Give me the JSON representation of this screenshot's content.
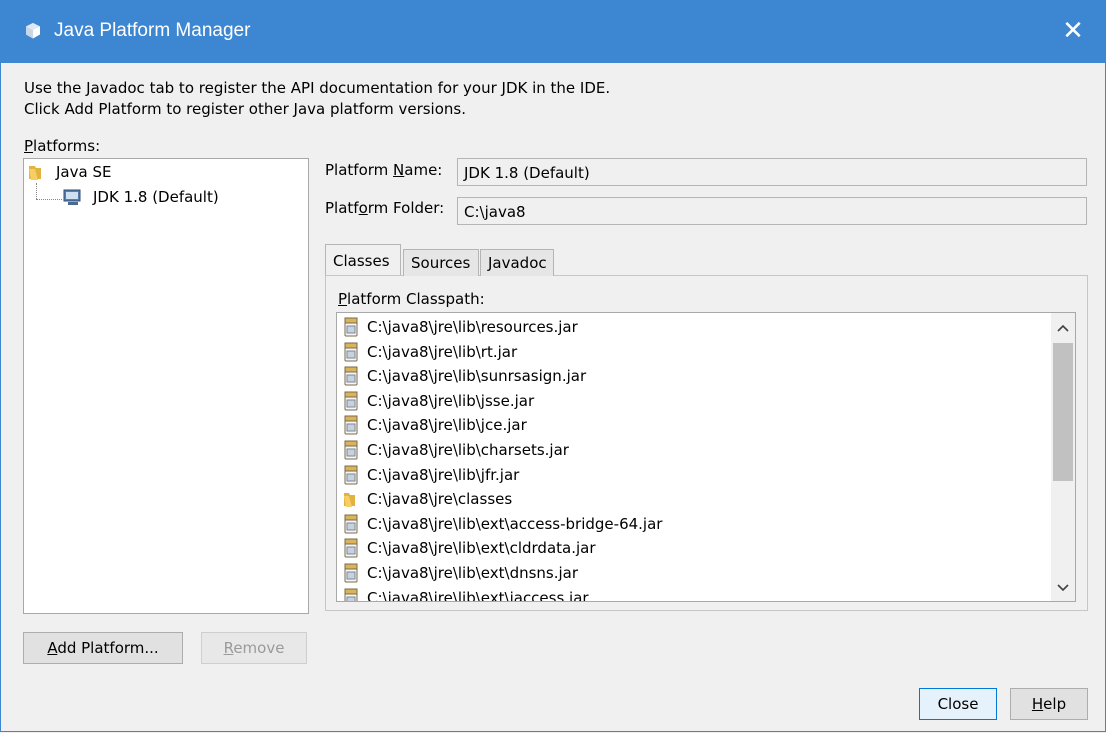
{
  "window": {
    "title": "Java Platform Manager",
    "close_glyph": "✕"
  },
  "description": {
    "line1": "Use the Javadoc tab to register the API documentation for your JDK in the IDE.",
    "line2": "Click Add Platform to register other Java platform versions."
  },
  "platforms": {
    "label_mnemonic": "P",
    "label_rest": "latforms:",
    "tree": {
      "root": "Java SE",
      "child": "JDK 1.8 (Default)"
    }
  },
  "details": {
    "name_label_pre": "Platform ",
    "name_label_mnemonic": "N",
    "name_label_post": "ame:",
    "name_value": "JDK 1.8 (Default)",
    "folder_label_pre": "Platf",
    "folder_label_mnemonic": "o",
    "folder_label_post": "rm Folder:",
    "folder_value": "C:\\java8"
  },
  "tabs": {
    "classes": "Classes",
    "sources": "Sources",
    "javadoc": "Javadoc"
  },
  "classpath": {
    "label_mnemonic": "P",
    "label_rest": "latform Classpath:",
    "items": [
      {
        "path": "C:\\java8\\jre\\lib\\resources.jar",
        "icon": "jar-icon"
      },
      {
        "path": "C:\\java8\\jre\\lib\\rt.jar",
        "icon": "jar-icon"
      },
      {
        "path": "C:\\java8\\jre\\lib\\sunrsasign.jar",
        "icon": "jar-icon"
      },
      {
        "path": "C:\\java8\\jre\\lib\\jsse.jar",
        "icon": "jar-icon"
      },
      {
        "path": "C:\\java8\\jre\\lib\\jce.jar",
        "icon": "jar-icon"
      },
      {
        "path": "C:\\java8\\jre\\lib\\charsets.jar",
        "icon": "jar-icon"
      },
      {
        "path": "C:\\java8\\jre\\lib\\jfr.jar",
        "icon": "jar-icon"
      },
      {
        "path": "C:\\java8\\jre\\classes",
        "icon": "folder-icon"
      },
      {
        "path": "C:\\java8\\jre\\lib\\ext\\access-bridge-64.jar",
        "icon": "jar-icon"
      },
      {
        "path": "C:\\java8\\jre\\lib\\ext\\cldrdata.jar",
        "icon": "jar-icon"
      },
      {
        "path": "C:\\java8\\jre\\lib\\ext\\dnsns.jar",
        "icon": "jar-icon"
      },
      {
        "path": "C:\\java8\\jre\\lib\\ext\\jaccess.jar",
        "icon": "jar-icon"
      }
    ]
  },
  "buttons": {
    "add_mnemonic": "A",
    "add_rest": "dd Platform...",
    "remove_mnemonic": "R",
    "remove_rest": "emove",
    "close": "Close",
    "help_mnemonic": "H",
    "help_rest": "elp"
  },
  "colors": {
    "titlebar": "#3c86d2",
    "focus_border": "#0078d7"
  }
}
